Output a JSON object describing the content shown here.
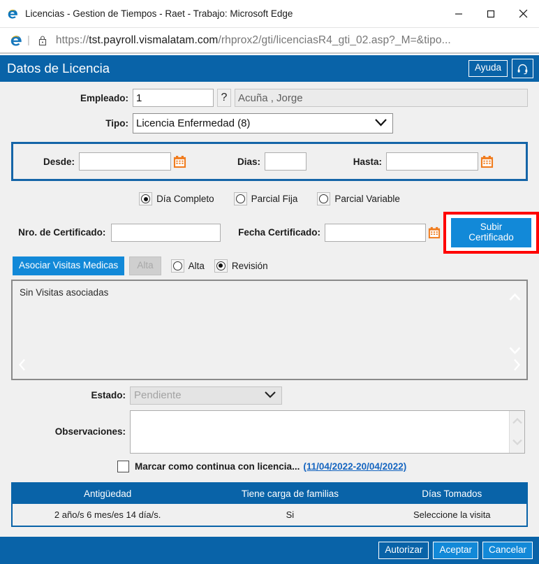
{
  "browser": {
    "title": "Licencias - Gestion de Tiempos - Raet - Trabajo: Microsoft Edge",
    "app_icon": "edge-e-icon",
    "minimize": "—",
    "maximize": "☐",
    "close": "✕",
    "url_prefix": "https://",
    "url_host": "tst.payroll.vismalatam.com",
    "url_path": "/rhprox2/gti/licenciasR4_gti_02.asp?_M=&tipo...",
    "lock_icon": "padlock-icon",
    "site_icon": "internet-explorer-icon"
  },
  "header": {
    "title": "Datos de Licencia",
    "help_label": "Ayuda",
    "support_icon": "headset-icon",
    "bg_color": "#0963a8"
  },
  "form": {
    "empleado_label": "Empleado:",
    "empleado_value": "1",
    "lookup_label": "?",
    "empleado_name": "Acuña , Jorge",
    "tipo_label": "Tipo:",
    "tipo_value": "Licencia Enfermedad (8)",
    "desde_label": "Desde:",
    "desde_value": "",
    "dias_label": "Dias:",
    "dias_value": "",
    "hasta_label": "Hasta:",
    "hasta_value": "",
    "calendar_icon": "calendar-icon",
    "calendar_color": "#f07c1e"
  },
  "duration_options": [
    {
      "label": "Día Completo",
      "selected": true
    },
    {
      "label": "Parcial Fija",
      "selected": false
    },
    {
      "label": "Parcial Variable",
      "selected": false
    }
  ],
  "certificate": {
    "nro_label": "Nro. de Certificado:",
    "nro_value": "",
    "fecha_label": "Fecha Certificado:",
    "fecha_value": "",
    "upload_button": "Subir Certificado",
    "highlight_color": "#ff0000"
  },
  "visits": {
    "associate_button": "Asociar Visitas Medicas",
    "alta_button": "Alta",
    "radios": [
      {
        "label": "Alta",
        "selected": false
      },
      {
        "label": "Revisión",
        "selected": true
      }
    ],
    "empty_text": "Sin Visitas asociadas",
    "scroll_up_icon": "chevron-up-icon",
    "scroll_down_icon": "chevron-down-icon",
    "scroll_left_icon": "chevron-left-icon",
    "scroll_right_icon": "chevron-right-icon"
  },
  "status": {
    "estado_label": "Estado:",
    "estado_value": "Pendiente",
    "observaciones_label": "Observaciones:",
    "observaciones_value": "",
    "continua_checkbox_label": "Marcar como continua con licencia...",
    "continua_link": "(11/04/2022-20/04/2022)"
  },
  "table": {
    "columns": [
      "Antigüedad",
      "Tiene carga de familias",
      "Días Tomados"
    ],
    "rows": [
      [
        "2 año/s 6 mes/es 14 día/s.",
        "Si",
        "Seleccione la visita"
      ]
    ]
  },
  "footer": {
    "buttons": [
      {
        "label": "Autorizar",
        "accent": false
      },
      {
        "label": "Aceptar",
        "accent": true
      },
      {
        "label": "Cancelar",
        "accent": true
      }
    ]
  }
}
